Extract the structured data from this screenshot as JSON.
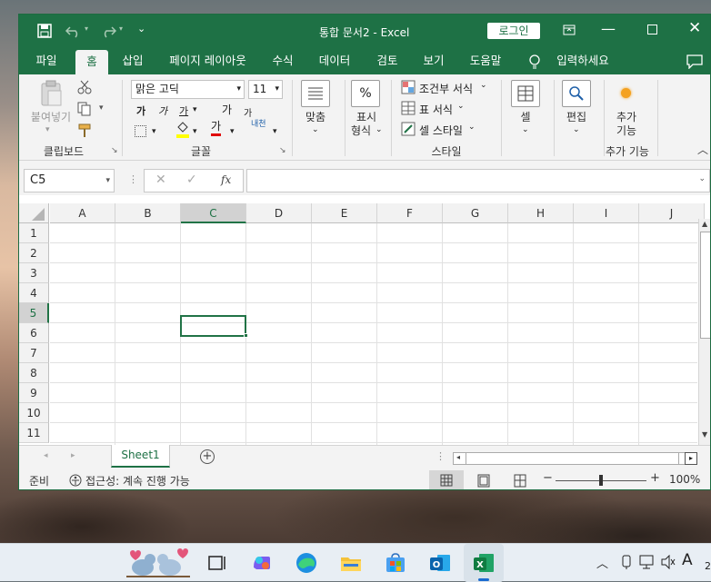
{
  "window": {
    "title": "통합 문서2  -  Excel",
    "login_label": "로그인"
  },
  "tabs": [
    "파일",
    "홈",
    "삽입",
    "페이지 레이아웃",
    "수식",
    "데이터",
    "검토",
    "보기",
    "도움말"
  ],
  "tell_me": "입력하세요",
  "ribbon": {
    "clipboard": {
      "paste": "붙여넣기",
      "label": "클립보드"
    },
    "font": {
      "name": "맑은 고딕",
      "size": "11",
      "bold": "가",
      "italic": "가",
      "underline": "가",
      "grow": "가",
      "shrink": "가",
      "fontcolor": "가",
      "phonetic": "내천",
      "label": "글꼴"
    },
    "alignment": {
      "label": "맞춤"
    },
    "number": {
      "label1": "표시",
      "label2": "형식"
    },
    "styles": {
      "conditional": "조건부 서식",
      "table": "표 서식",
      "cell": "셀 스타일",
      "label": "스타일"
    },
    "cells": {
      "label": "셀"
    },
    "editing": {
      "label": "편집"
    },
    "addins": {
      "button1": "추가",
      "button2": "기능",
      "label": "추가 기능"
    }
  },
  "formula": {
    "namebox": "C5",
    "fx": "fx"
  },
  "columns": [
    "A",
    "B",
    "C",
    "D",
    "E",
    "F",
    "G",
    "H",
    "I",
    "J"
  ],
  "rows": [
    "1",
    "2",
    "3",
    "4",
    "5",
    "6",
    "7",
    "8",
    "9",
    "10",
    "11"
  ],
  "sheet": {
    "tab": "Sheet1"
  },
  "status": {
    "ready": "준비",
    "accessibility": "접근성: 계속 진행 가능",
    "zoom": "100%"
  },
  "taskbar": {
    "a_label": "A",
    "clock": "2"
  },
  "colors": {
    "excel_green": "#1e7145",
    "selection_green": "#217346"
  }
}
